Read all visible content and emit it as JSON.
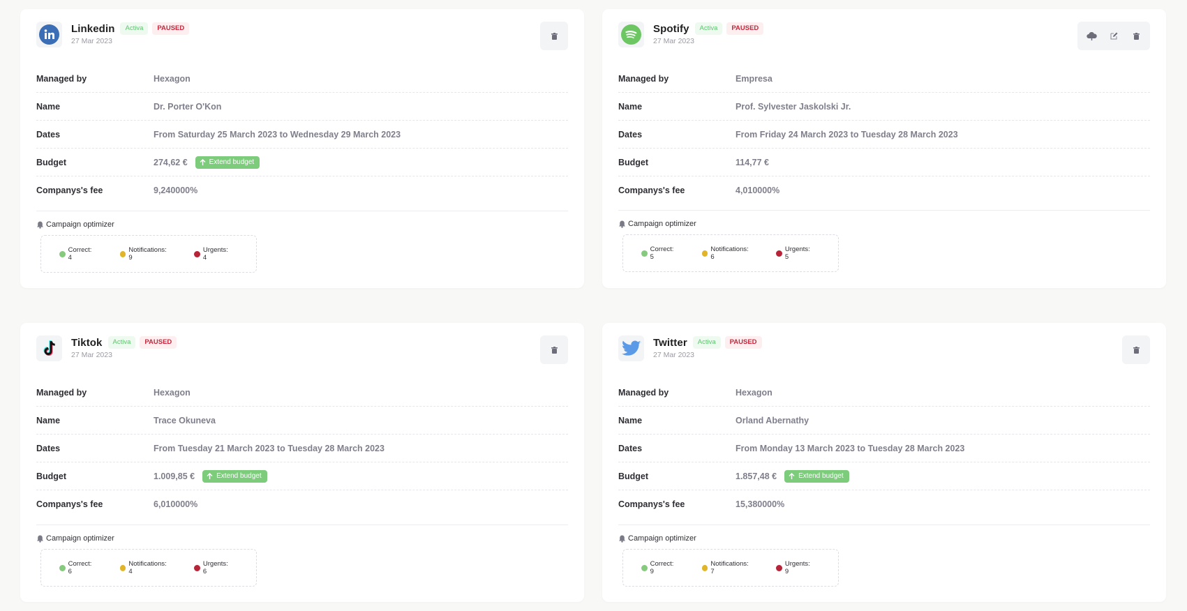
{
  "colors": {
    "active_text": "#5fc270",
    "paused_text": "#c4283c",
    "extend_bg": "#7ccc7c",
    "correct": "#85ca7d",
    "notifications": "#e0b52a",
    "urgents": "#b82437"
  },
  "labels": {
    "managed_by": "Managed by",
    "name": "Name",
    "dates": "Dates",
    "budget": "Budget",
    "fee": "Companys's fee",
    "optimizer": "Campaign optimizer",
    "extend_budget": "Extend budget"
  },
  "campaigns": [
    {
      "platform": "Linkedin",
      "logo_icon": "linkedin-icon",
      "status_active": "Activa",
      "status_paused": "PAUSED",
      "date": "27 Mar 2023",
      "managed_by": "Hexagon",
      "name": "Dr. Porter O'Kon",
      "dates": "From Saturday 25 March 2023 to Wednesday 29 March 2023",
      "budget": "274,62 €",
      "fee": "9,240000%",
      "correct": "Correct: 4",
      "notifications": "Notifications: 9",
      "urgents": "Urgents: 4",
      "actions": [
        "trash-icon"
      ]
    },
    {
      "platform": "Spotify",
      "logo_icon": "spotify-icon",
      "status_active": "Activa",
      "status_paused": "PAUSED",
      "date": "27 Mar 2023",
      "managed_by": "Empresa",
      "name": "Prof. Sylvester Jaskolski Jr.",
      "dates": "From Friday 24 March 2023 to Tuesday 28 March 2023",
      "budget": "114,77 €",
      "fee": "4,010000%",
      "correct": "Correct: 5",
      "notifications": "Notifications: 6",
      "urgents": "Urgents: 5",
      "actions": [
        "cloud-upload-icon",
        "edit-icon",
        "trash-icon"
      ]
    },
    {
      "platform": "Tiktok",
      "logo_icon": "tiktok-icon",
      "status_active": "Activa",
      "status_paused": "PAUSED",
      "date": "27 Mar 2023",
      "managed_by": "Hexagon",
      "name": "Trace Okuneva",
      "dates": "From Tuesday 21 March 2023 to Tuesday 28 March 2023",
      "budget": "1.009,85 €",
      "fee": "6,010000%",
      "correct": "Correct: 6",
      "notifications": "Notifications: 4",
      "urgents": "Urgents: 6",
      "actions": [
        "trash-icon"
      ]
    },
    {
      "platform": "Twitter",
      "logo_icon": "twitter-icon",
      "status_active": "Activa",
      "status_paused": "PAUSED",
      "date": "27 Mar 2023",
      "managed_by": "Hexagon",
      "name": "Orland Abernathy",
      "dates": "From Monday 13 March 2023 to Tuesday 28 March 2023",
      "budget": "1.857,48 €",
      "fee": "15,380000%",
      "correct": "Correct: 9",
      "notifications": "Notifications: 7",
      "urgents": "Urgents: 9",
      "actions": [
        "trash-icon"
      ]
    }
  ]
}
